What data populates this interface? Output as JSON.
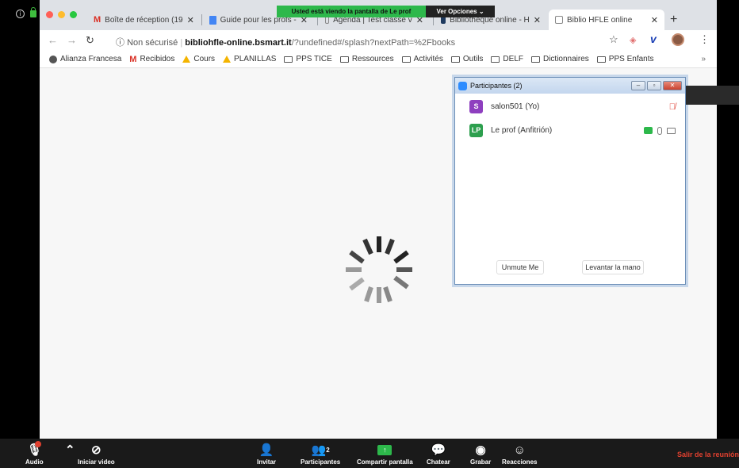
{
  "zoom_banner": {
    "text": "Usted está viendo la pantalla de Le prof",
    "options": "Ver Opciones ⌄"
  },
  "tabs": [
    {
      "title": "Boîte de réception (19"
    },
    {
      "title": "Guide pour les profs - "
    },
    {
      "title": "Agenda | Test classe v"
    },
    {
      "title": "Bibliothèque online - H"
    },
    {
      "title": "Biblio HFLE online"
    }
  ],
  "address": {
    "security": "Non sécurisé",
    "domain": "bibliohfle-online.bsmart.it",
    "path": "/?undefined#/splash?nextPath=%2Fbooks"
  },
  "bookmarks": [
    {
      "label": "Alianza Francesa",
      "icon": "globe-icon"
    },
    {
      "label": "Recibidos",
      "icon": "gmail-icon"
    },
    {
      "label": "Cours",
      "icon": "drive-icon"
    },
    {
      "label": "PLANILLAS",
      "icon": "drive-icon"
    },
    {
      "label": "PPS TICE",
      "icon": "folder-icon"
    },
    {
      "label": "Ressources",
      "icon": "folder-icon"
    },
    {
      "label": "Activités",
      "icon": "folder-icon"
    },
    {
      "label": "Outils",
      "icon": "folder-icon"
    },
    {
      "label": "DELF",
      "icon": "folder-icon"
    },
    {
      "label": "Dictionnaires",
      "icon": "folder-icon"
    },
    {
      "label": "PPS Enfants",
      "icon": "folder-icon"
    }
  ],
  "bookmarks_more": "»",
  "participants_panel": {
    "title": "Participantes (2)",
    "participants": [
      {
        "initials": "S",
        "name": "salon501 (Yo)",
        "color": "#8e3fbf"
      },
      {
        "initials": "LP",
        "name": "Le prof (Anfitrión)",
        "color": "#2d9f4e"
      }
    ],
    "unmute_label": "Unmute Me",
    "raise_hand_label": "Levantar la mano"
  },
  "toolbar": {
    "audio": "Audio",
    "video": "Iniciar video",
    "invite": "Invitar",
    "participants": "Participantes",
    "participants_count": "2",
    "share": "Compartir pantalla",
    "chat": "Chatear",
    "record": "Grabar",
    "reactions": "Reacciones",
    "leave": "Salir de la reunión"
  },
  "colors": {
    "zoom_green": "#2db84b",
    "leave_red": "#e0402f",
    "toolbar_bg": "#1a1a1a"
  }
}
